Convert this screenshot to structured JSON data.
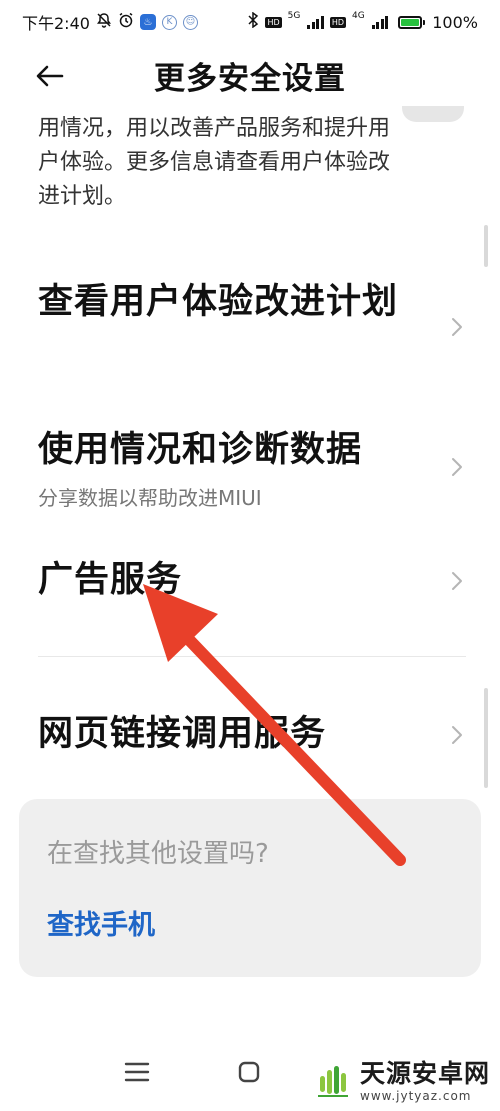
{
  "status_bar": {
    "time": "下午2:40",
    "net1": "5G",
    "net2": "4G",
    "hd": "HD",
    "battery": "100%",
    "battery_level": 1.0,
    "icons": [
      "mute-bell-icon",
      "alarm-icon",
      "app-notification-icon",
      "k-app-icon",
      "app-badge-icon",
      "bluetooth-icon",
      "signal-icon",
      "battery-icon"
    ]
  },
  "header": {
    "title": "更多安全设置",
    "back_icon": "back-arrow-icon"
  },
  "description": {
    "text": "允许小米收集相关信息分析产品的使用情况，用以改善产品服务和提升用户体验。更多信息请查看用户体验改进计划。"
  },
  "items": [
    {
      "title": "查看用户体验改进计划",
      "subtitle": ""
    },
    {
      "title": "使用情况和诊断数据",
      "subtitle": "分享数据以帮助改进MIUI"
    },
    {
      "title": "广告服务",
      "subtitle": ""
    },
    {
      "title": "网页链接调用服务",
      "subtitle": ""
    }
  ],
  "search_card": {
    "question": "在查找其他设置吗?",
    "link": "查找手机"
  },
  "nav_bar": {
    "icons": [
      "menu-icon",
      "home-icon",
      "back-icon"
    ]
  },
  "watermark": {
    "title": "天源安卓网",
    "url": "www.jytyaz.com"
  },
  "colors": {
    "background": "#ffffff",
    "text": "#111111",
    "subtitle": "#777777",
    "link": "#1f66c7",
    "card": "#efefef",
    "arrow": "#e8402a"
  }
}
